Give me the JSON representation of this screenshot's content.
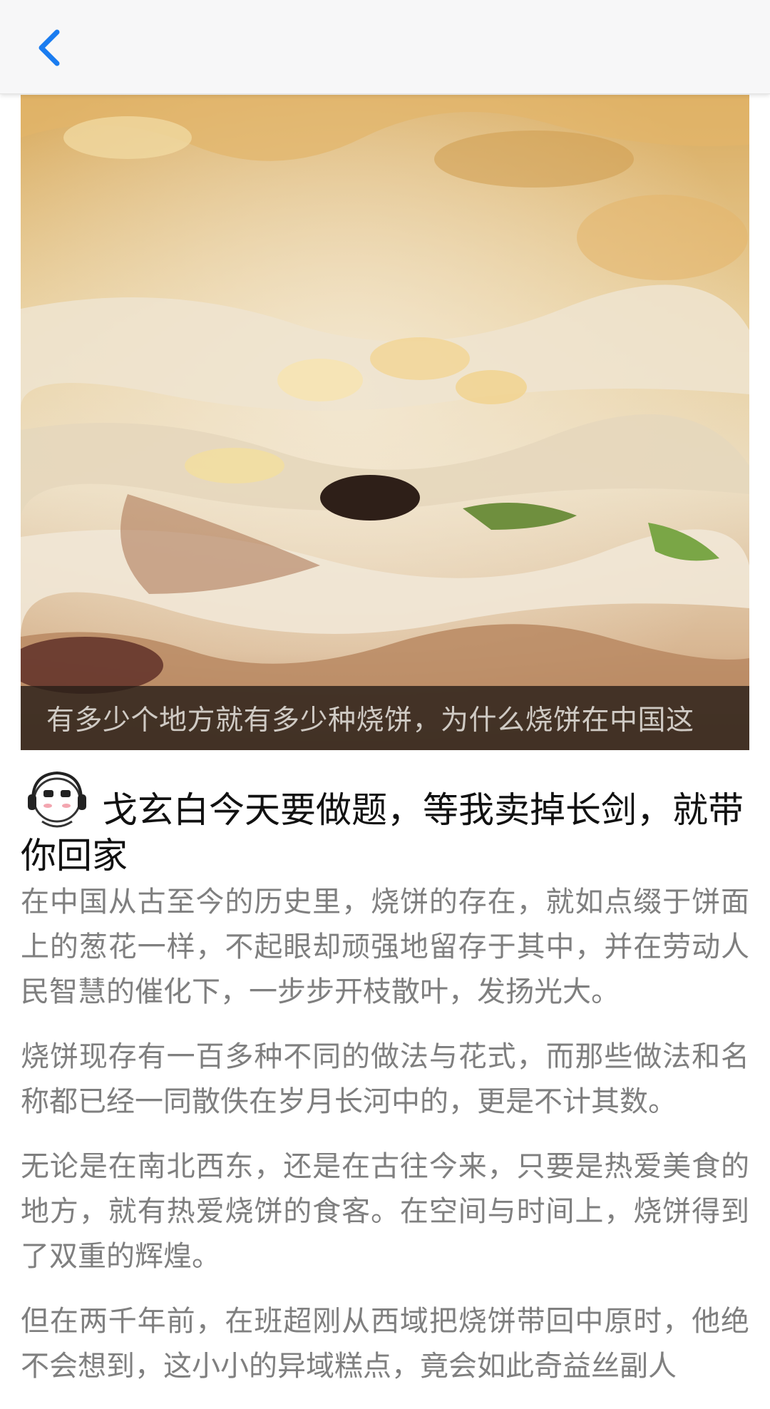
{
  "navbar": {
    "back_icon": "chevron-left-icon",
    "accent_color": "#1a7cf0"
  },
  "hero": {
    "image_description_icon": "food-photo-flatbread",
    "caption": "有多少个地方就有多少种烧饼，为什么烧饼在中国这"
  },
  "author": {
    "avatar_icon": "cartoon-headphones-avatar",
    "name": "戈玄白今天要做题，等我卖掉长剑，就带你回家"
  },
  "article": {
    "paragraphs": [
      "在中国从古至今的历史里，烧饼的存在，就如点缀于饼面上的葱花一样，不起眼却顽强地留存于其中，并在劳动人民智慧的催化下，一步步开枝散叶，发扬光大。",
      "烧饼现存有一百多种不同的做法与花式，而那些做法和名称都已经一同散佚在岁月长河中的，更是不计其数。",
      "无论是在南北西东，还是在古往今来，只要是热爱美食的地方，就有热爱烧饼的食客。在空间与时间上，烧饼得到了双重的辉煌。",
      "但在两千年前，在班超刚从西域把烧饼带回中原时，他绝不会想到，这小小的异域糕点，竟会如此奇益丝副人"
    ]
  }
}
